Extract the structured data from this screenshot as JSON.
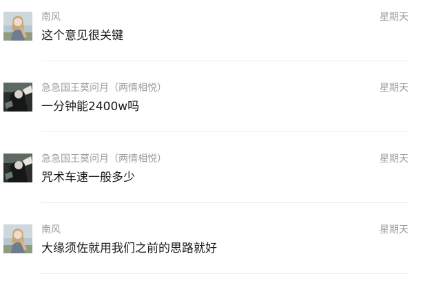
{
  "messages": [
    {
      "sender": "南风",
      "time": "星期天",
      "text": "这个意见很关键",
      "avatar_icon": "anime-girl-avatar-icon"
    },
    {
      "sender": "急急国王莫问月（两情相悦）",
      "time": "星期天",
      "text": "一分钟能2400w吗",
      "avatar_icon": "dark-character-avatar-icon"
    },
    {
      "sender": "急急国王莫问月（两情相悦）",
      "time": "星期天",
      "text": "咒术车速一般多少",
      "avatar_icon": "dark-character-avatar-icon"
    },
    {
      "sender": "南风",
      "time": "星期天",
      "text": "大缘须佐就用我们之前的思路就好",
      "avatar_icon": "anime-girl-avatar-icon"
    }
  ],
  "colors": {
    "meta_text": "#9b9b9b",
    "body_text": "#1a1a1a",
    "divider": "#ececec",
    "background": "#ffffff"
  }
}
